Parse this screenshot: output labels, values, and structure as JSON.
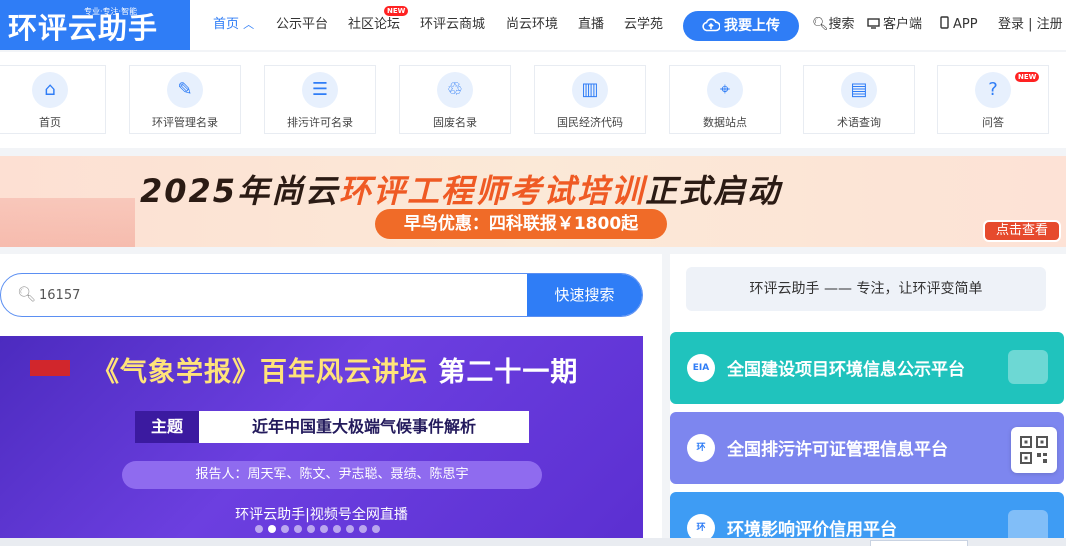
{
  "logo": {
    "main": "环评云助手",
    "tagline": "专业·专注·智能"
  },
  "nav": {
    "items": [
      {
        "label": "首页",
        "active": true
      },
      {
        "label": "公示平台"
      },
      {
        "label": "社区论坛",
        "badge": "NEW"
      },
      {
        "label": "环评云商城"
      },
      {
        "label": "尚云环境"
      },
      {
        "label": "直播"
      },
      {
        "label": "云学苑"
      }
    ],
    "upload_label": "我要上传",
    "search_label": "搜索",
    "client_label": "客户端",
    "app_label": "APP",
    "login_label": "登录 | 注册"
  },
  "tiles": [
    {
      "label": "首页",
      "icon": "home-icon"
    },
    {
      "label": "环评管理名录",
      "icon": "edit-icon"
    },
    {
      "label": "排污许可名录",
      "icon": "id-card-icon"
    },
    {
      "label": "固废名录",
      "icon": "recycle-icon"
    },
    {
      "label": "国民经济代码",
      "icon": "bar-chart-icon"
    },
    {
      "label": "数据站点",
      "icon": "location-icon"
    },
    {
      "label": "术语查询",
      "icon": "book-icon"
    },
    {
      "label": "问答",
      "icon": "question-icon",
      "badge": "NEW"
    }
  ],
  "banner": {
    "title_prefix": "2025年尚云",
    "title_highlight": "环评工程师考试培训",
    "title_suffix": "正式启动",
    "offer": "早鸟优惠：四科联报￥1800起",
    "cta": "点击查看"
  },
  "search": {
    "value": "16157",
    "button": "快速搜索"
  },
  "slide": {
    "headline_highlight": "《气象学报》百年风云讲坛",
    "headline_plain": "第二十一期",
    "topic_tag": "主题",
    "topic": "近年中国重大极端气候事件解析",
    "speakers": "报告人：周天军、陈文、尹志聪、聂绩、陈思宇",
    "footer": "环评云助手|视频号全网直播",
    "dots_total": 10,
    "dots_active": 1
  },
  "right": {
    "slogan": "环评云助手 —— 专注，让环评变简单",
    "platforms": [
      {
        "label": "全国建设项目环境信息公示平台",
        "emblem": "EIA",
        "color": "#20c3bd"
      },
      {
        "label": "全国排污许可证管理信息平台",
        "emblem": "环",
        "color": "#7d86ef"
      },
      {
        "label": "环境影响评价信用平台",
        "emblem": "环",
        "color": "#3e9cf4"
      }
    ]
  }
}
